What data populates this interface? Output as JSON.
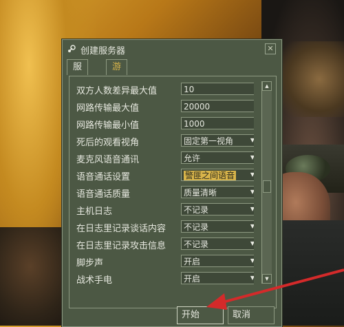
{
  "window": {
    "title": "创建服务器",
    "close_symbol": "✕",
    "tabs": [
      {
        "label": "服务器",
        "active": false
      },
      {
        "label": "游戏",
        "active": true
      }
    ]
  },
  "settings": [
    {
      "label": "双方人数差异最大值",
      "value": "10",
      "type": "text"
    },
    {
      "label": "网路传输最大值",
      "value": "20000",
      "type": "text"
    },
    {
      "label": "网路传输最小值",
      "value": "1000",
      "type": "text"
    },
    {
      "label": "死后的观看视角",
      "value": "固定第一视角",
      "type": "select"
    },
    {
      "label": "麦克风语音通讯",
      "value": "允许",
      "type": "select"
    },
    {
      "label": "语音通话设置",
      "value": "警匪之间语音",
      "type": "select",
      "highlight": true
    },
    {
      "label": "语音通话质量",
      "value": "质量清晰",
      "type": "select"
    },
    {
      "label": "主机日志",
      "value": "不记录",
      "type": "select"
    },
    {
      "label": "在日志里记录谈话内容",
      "value": "不记录",
      "type": "select"
    },
    {
      "label": "在日志里记录攻击信息",
      "value": "不记录",
      "type": "select"
    },
    {
      "label": "脚步声",
      "value": "开启",
      "type": "select"
    },
    {
      "label": "战术手电",
      "value": "开启",
      "type": "select"
    }
  ],
  "buttons": {
    "start": "开始",
    "cancel": "取消"
  },
  "colors": {
    "window_bg": "#4c5844",
    "text": "#e6e8df",
    "accent": "#d8b44a",
    "annotation_arrow": "#d42a2a"
  },
  "icons": {
    "title": "steam-icon",
    "close": "close-icon",
    "scroll_up": "scroll-up-icon",
    "scroll_down": "scroll-down-icon",
    "dropdown": "chevron-down-icon"
  }
}
